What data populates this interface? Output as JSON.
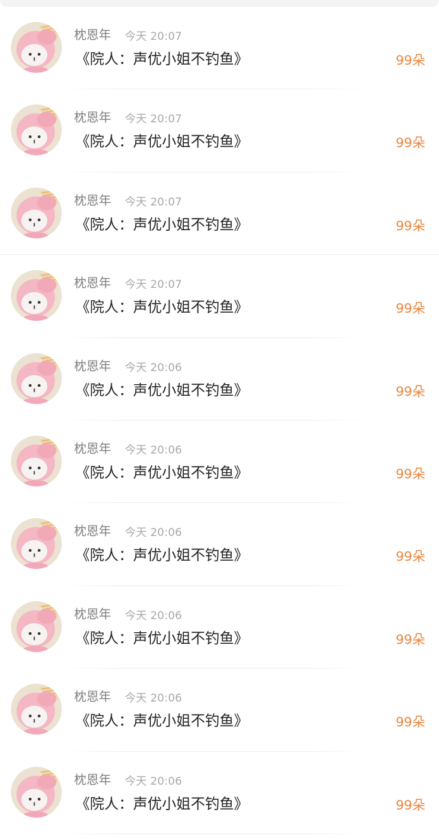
{
  "comments": [
    {
      "name": "枕恩年",
      "time": "今天 20:07",
      "title": "《院人：声优小姐不钓鱼》",
      "amount": "99朵"
    },
    {
      "name": "枕恩年",
      "time": "今天 20:07",
      "title": "《院人：声优小姐不钓鱼》",
      "amount": "99朵"
    },
    {
      "name": "枕恩年",
      "time": "今天 20:07",
      "title": "《院人：声优小姐不钓鱼》",
      "amount": "99朵"
    },
    {
      "name": "枕恩年",
      "time": "今天 20:07",
      "title": "《院人：声优小姐不钓鱼》",
      "amount": "99朵"
    },
    {
      "name": "枕恩年",
      "time": "今天 20:06",
      "title": "《院人：声优小姐不钓鱼》",
      "amount": "99朵"
    },
    {
      "name": "枕恩年",
      "time": "今天 20:06",
      "title": "《院人：声优小姐不钓鱼》",
      "amount": "99朵"
    },
    {
      "name": "枕恩年",
      "time": "今天 20:06",
      "title": "《院人：声优小姐不钓鱼》",
      "amount": "99朵"
    },
    {
      "name": "枕恩年",
      "time": "今天 20:06",
      "title": "《院人：声优小姐不钓鱼》",
      "amount": "99朵"
    },
    {
      "name": "枕恩年",
      "time": "今天 20:06",
      "title": "《院人：声优小姐不钓鱼》",
      "amount": "99朵"
    },
    {
      "name": "枕恩年",
      "time": "今天 20:06",
      "title": "《院人：声优小姐不钓鱼》",
      "amount": "99朵"
    }
  ],
  "colors": {
    "amount": "#e8863e",
    "name": "#7e7e7e",
    "time": "#a8a8a8",
    "title": "#222222"
  },
  "icons": {
    "avatar": "pink-bunny-hat-avatar-icon"
  }
}
